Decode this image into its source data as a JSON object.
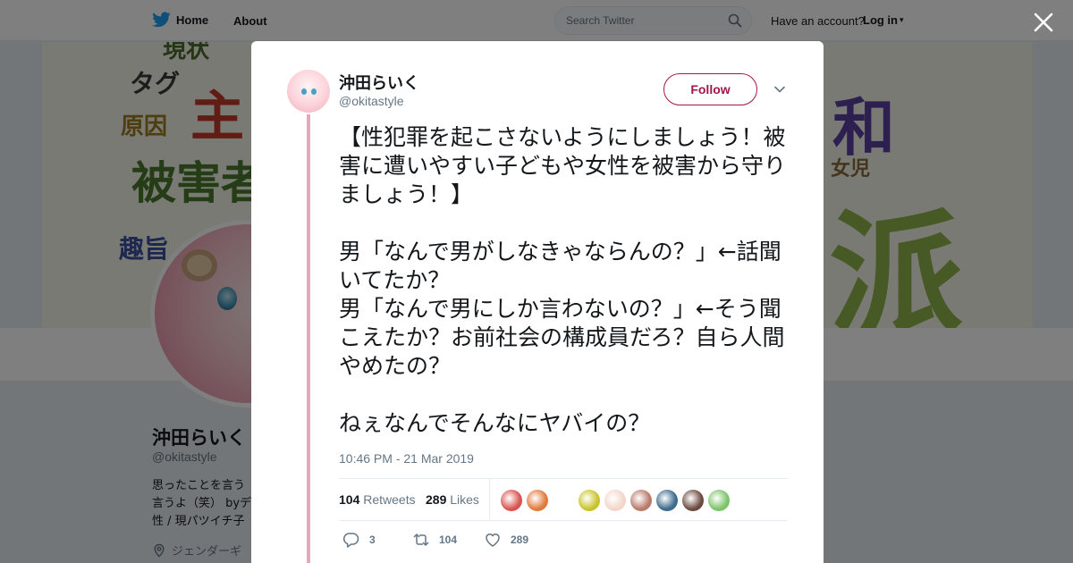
{
  "nav": {
    "home_label": "Home",
    "about_label": "About",
    "search_placeholder": "Search Twitter",
    "have_account": "Have an account?",
    "login_label": "Log in",
    "login_caret": "▾"
  },
  "banner": {
    "words": [
      "現状",
      "タグ",
      "主",
      "原因",
      "被害者",
      "趣旨",
      "和",
      "女児",
      "派"
    ]
  },
  "profile": {
    "name": "沖田らいく",
    "handle": "@okitastyle",
    "bio": "思ったことを言う\n言うよ（笑） byデ\n性 / 現パツイチ子",
    "location": "ジェンダーギ"
  },
  "tweet": {
    "author_name": "沖田らいく",
    "author_handle": "@okitastyle",
    "follow_label": "Follow",
    "text": "【性犯罪を起こさないようにしましょう！被害に遭いやすい子どもや女性を被害から守りましょう！】\n\n男「なんで男がしなきゃならんの？」←話聞いてたか？\n男「なんで男にしか言わないの？」←そう聞こえたか？お前社会の構成員だろ？自ら人間やめたの？\n\nねぇなんでそんなにヤバイの？",
    "timestamp": "10:46 PM - 21 Mar 2019",
    "retweets_count": "104",
    "retweets_label": "Retweets",
    "likes_count": "289",
    "likes_label": "Likes",
    "reply_count": "3",
    "retweet_action_count": "104",
    "like_action_count": "289"
  },
  "colors": {
    "accent": "#a0174a",
    "twitter_blue": "#1da1f2",
    "thread_line": "#e5a8b8",
    "liker_avatars": [
      "#d9534f",
      "#e07a3c",
      "#ffffff",
      "#c9c32b",
      "#f2d6c9",
      "#b87b6a",
      "#3d6b8c",
      "#6b4b3e",
      "#7cc46a"
    ]
  },
  "icons": [
    "twitter-bird-icon",
    "search-icon",
    "close-icon",
    "chevron-down-icon",
    "reply-icon",
    "retweet-icon",
    "like-icon",
    "location-icon"
  ]
}
